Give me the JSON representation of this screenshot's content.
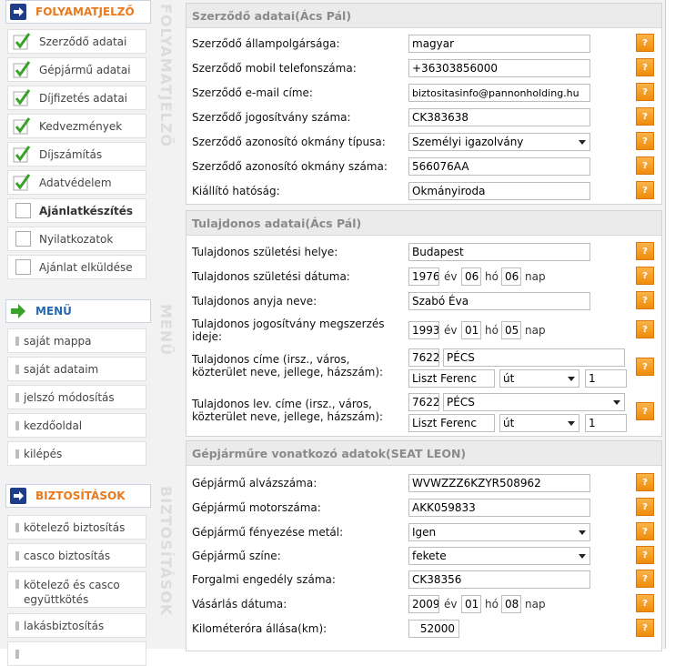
{
  "sidebar": {
    "progress_title": "FOLYAMATJELZŐ",
    "progress_items": [
      {
        "label": "Szerződő adatai",
        "done": true
      },
      {
        "label": "Gépjármű adatai",
        "done": true
      },
      {
        "label": "Díjfizetés adatai",
        "done": true
      },
      {
        "label": "Kedvezmények",
        "done": true
      },
      {
        "label": "Díjszámítás",
        "done": true
      },
      {
        "label": "Adatvédelem",
        "done": true
      },
      {
        "label": "Ajánlatkészítés",
        "done": false,
        "current": true
      },
      {
        "label": "Nyilatkozatok",
        "done": false
      },
      {
        "label": "Ajánlat elküldése",
        "done": false
      }
    ],
    "menu_title": "MENÜ",
    "menu_items": [
      "saját mappa",
      "saját adataim",
      "jelszó módosítás",
      "kezdőoldal",
      "kilépés"
    ],
    "insurance_title": "BIZTOSÍTÁSOK",
    "insurance_items": [
      "kötelező biztosítás",
      "casco biztosítás",
      "kötelező és casco",
      "együttkötés",
      "lakásbiztosítás"
    ]
  },
  "gutter": {
    "label1": "FOLYAMATJELZŐ",
    "label2": "MENÜ",
    "label3": "BIZTOSÍTÁSOK"
  },
  "colors": {
    "accent_orange": "#e8791c",
    "accent_blue": "#2869ae",
    "check_green": "#3aa12b"
  },
  "contract": {
    "title": "Szerződő adatai(Ács Pál)",
    "fields": [
      {
        "label": "Szerződő állampolgársága:",
        "value": "magyar"
      },
      {
        "label": "Szerződő mobil telefonszáma:",
        "value": "+36303856000"
      },
      {
        "label": "Szerződő e-mail címe:",
        "value": "biztositasinfo@pannonholding.hu"
      },
      {
        "label": "Szerződő jogosítvány száma:",
        "value": "CK383638"
      },
      {
        "label": "Szerződő azonosító okmány típusa:",
        "value": "Személyi igazolvány"
      },
      {
        "label": "Szerződő azonosító okmány száma:",
        "value": "566076AA"
      },
      {
        "label": "Kiállító hatóság:",
        "value": "Okmányiroda"
      }
    ]
  },
  "owner": {
    "title": "Tulajdonos adatai(Ács Pál)",
    "birthplace_label": "Tulajdonos születési helye:",
    "birthplace": "Budapest",
    "birthdate_label": "Tulajdonos születési dátuma:",
    "birth_year": "1976",
    "birth_month": "06",
    "birth_day": "06",
    "mother_label": "Tulajdonos anyja neve:",
    "mother": "Szabó Éva",
    "license_label_1": "Tulajdonos jogosítvány megszerzés",
    "license_label_2": "ideje:",
    "license_year": "1993",
    "license_month": "01",
    "license_day": "05",
    "address_label_1": "Tulajdonos címe (irsz., város,",
    "address_label_2": "közterület neve, jellege, házszám):",
    "zip": "7622",
    "city": "PÉCS",
    "street": "Liszt Ferenc",
    "street_type": "út",
    "house": "1",
    "mail_label_1": "Tulajdonos lev. címe (irsz., város,",
    "mail_label_2": "közterület neve, jellege, házszám):",
    "mail_zip": "7622",
    "mail_city": "PÉCS",
    "mail_street": "Liszt Ferenc",
    "mail_street_type": "út",
    "mail_house": "1"
  },
  "units": {
    "year": "év",
    "month": "hó",
    "day": "nap"
  },
  "vehicle": {
    "title": "Gépjárműre vonatkozó adatok(SEAT LEON)",
    "chassis_label": "Gépjármű alvázszáma:",
    "chassis": "WVWZZZ6KZYR508962",
    "engine_label": "Gépjármű motorszáma:",
    "engine": "AKK059833",
    "metallic_label": "Gépjármű fényezése metál:",
    "metallic": "Igen",
    "color_label": "Gépjármű színe:",
    "color": "fekete",
    "registration_label": "Forgalmi engedély száma:",
    "registration": "CK38356",
    "purchase_label": "Vásárlás dátuma:",
    "purchase_year": "2009",
    "purchase_month": "01",
    "purchase_day": "08",
    "km_label": "Kilométeróra állása(km):",
    "km": "52000"
  },
  "help_label": "?"
}
